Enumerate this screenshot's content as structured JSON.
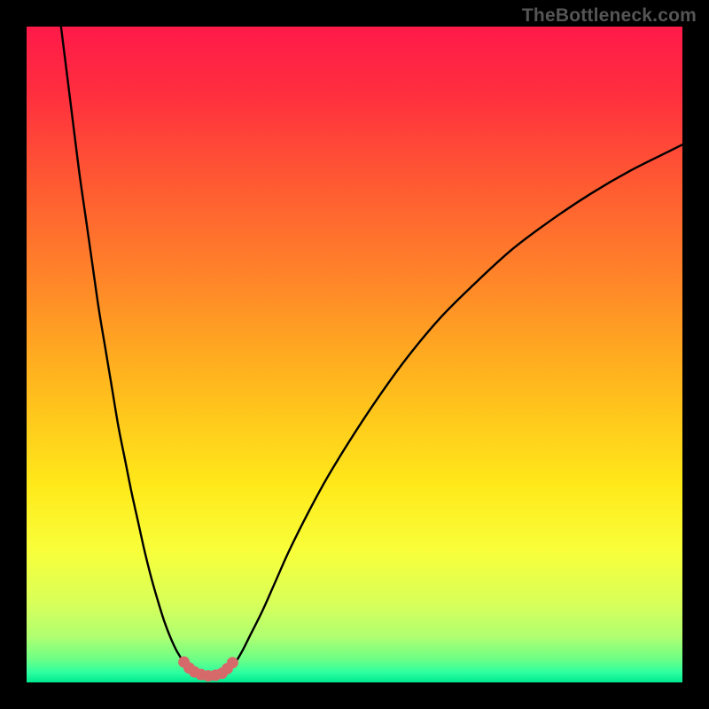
{
  "watermark": "TheBottleneck.com",
  "chart_data": {
    "type": "line",
    "title": "",
    "xlabel": "",
    "ylabel": "",
    "xlim": [
      0,
      100
    ],
    "ylim": [
      0,
      100
    ],
    "grid": false,
    "legend": false,
    "gradient_stops": [
      {
        "offset": 0.0,
        "color": "#ff1a49"
      },
      {
        "offset": 0.1,
        "color": "#ff2e3f"
      },
      {
        "offset": 0.24,
        "color": "#ff5a32"
      },
      {
        "offset": 0.4,
        "color": "#ff8a28"
      },
      {
        "offset": 0.55,
        "color": "#ffba1d"
      },
      {
        "offset": 0.7,
        "color": "#ffe91a"
      },
      {
        "offset": 0.8,
        "color": "#f8ff3a"
      },
      {
        "offset": 0.88,
        "color": "#d8ff5a"
      },
      {
        "offset": 0.93,
        "color": "#b0ff70"
      },
      {
        "offset": 0.965,
        "color": "#6cff86"
      },
      {
        "offset": 0.985,
        "color": "#2dffa0"
      },
      {
        "offset": 1.0,
        "color": "#00e890"
      }
    ],
    "series": [
      {
        "name": "bottleneck-curve-left",
        "stroke": "#000000",
        "x": [
          5,
          6,
          7,
          8,
          9,
          10,
          11,
          12,
          13,
          14,
          15,
          16,
          17,
          18,
          19,
          20,
          21,
          22,
          23,
          24,
          25,
          26
        ],
        "y": [
          102,
          94,
          86,
          78,
          71,
          64,
          57,
          51,
          45,
          39,
          34,
          29,
          24.5,
          20,
          16,
          12.5,
          9.3,
          6.7,
          4.6,
          3.1,
          2.1,
          1.6
        ]
      },
      {
        "name": "bottleneck-curve-right",
        "stroke": "#000000",
        "x": [
          30,
          31,
          32,
          33,
          34,
          36,
          38,
          40,
          43,
          46,
          50,
          54,
          58,
          63,
          68,
          74,
          80,
          86,
          92,
          98,
          100
        ],
        "y": [
          1.6,
          2.2,
          3.3,
          5.0,
          7.0,
          11.0,
          15.5,
          20.0,
          26.0,
          31.5,
          38.0,
          44.0,
          49.5,
          55.5,
          60.5,
          66.0,
          70.5,
          74.5,
          78.0,
          81.0,
          82.0
        ]
      }
    ],
    "markers": {
      "name": "optimal-zone",
      "stroke": "#d66a6a",
      "fill": "#d66a6a",
      "radius_px": 6.5,
      "points": [
        {
          "x": 24.0,
          "y": 3.1
        },
        {
          "x": 24.8,
          "y": 2.2
        },
        {
          "x": 25.6,
          "y": 1.6
        },
        {
          "x": 26.6,
          "y": 1.2
        },
        {
          "x": 27.7,
          "y": 1.0
        },
        {
          "x": 28.8,
          "y": 1.1
        },
        {
          "x": 29.8,
          "y": 1.4
        },
        {
          "x": 30.6,
          "y": 2.1
        },
        {
          "x": 31.4,
          "y": 3.0
        }
      ]
    }
  }
}
